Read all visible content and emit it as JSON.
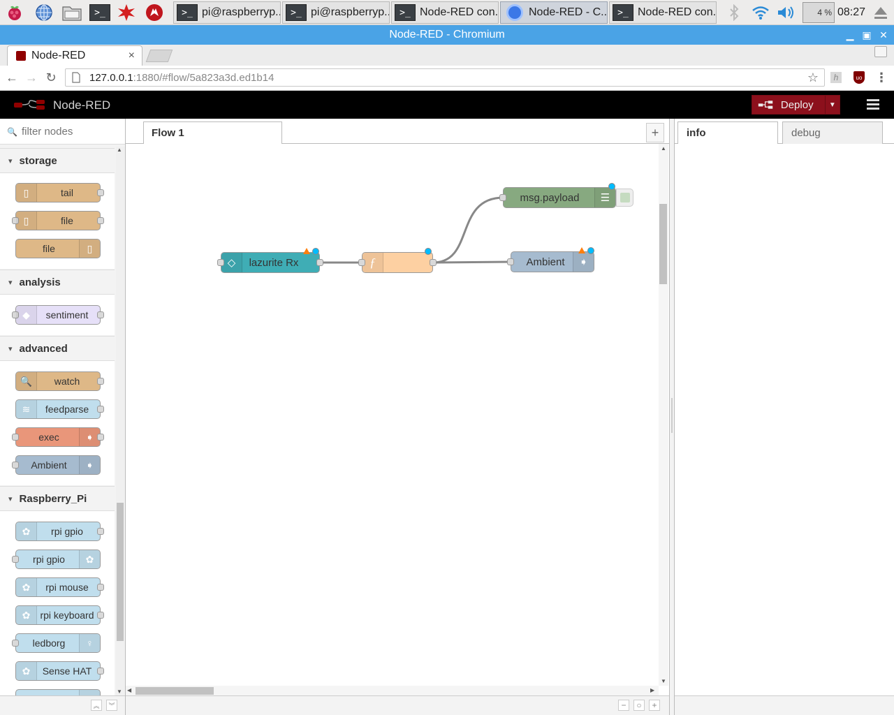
{
  "taskbar": {
    "launchers": [
      "raspberry-menu-icon",
      "web-browser-icon",
      "file-manager-icon",
      "terminal-icon",
      "math-kernel-icon",
      "wolfram-icon"
    ],
    "windows": [
      {
        "label": "pi@raspberryp...",
        "icon": "terminal"
      },
      {
        "label": "pi@raspberryp...",
        "icon": "terminal"
      },
      {
        "label": "Node-RED con...",
        "icon": "terminal"
      },
      {
        "label": "Node-RED - C...",
        "icon": "chromium",
        "active": true
      },
      {
        "label": "Node-RED con...",
        "icon": "terminal"
      }
    ],
    "cpu": "4 %",
    "clock": "08:27"
  },
  "window": {
    "title": "Node-RED - Chromium"
  },
  "browser": {
    "tab_title": "Node-RED",
    "url_host": "127.0.0.1",
    "url_path": ":1880/#flow/5a823a3d.ed1b14"
  },
  "app": {
    "brand": "Node-RED",
    "deploy_label": "Deploy",
    "accent": "#8c101c"
  },
  "palette": {
    "filter_placeholder": "filter nodes",
    "categories": [
      {
        "name": "storage",
        "nodes": [
          "tail",
          "file",
          "file"
        ]
      },
      {
        "name": "analysis",
        "nodes": [
          "sentiment"
        ]
      },
      {
        "name": "advanced",
        "nodes": [
          "watch",
          "feedparse",
          "exec",
          "Ambient"
        ]
      },
      {
        "name": "Raspberry_Pi",
        "nodes": [
          "rpi gpio",
          "rpi gpio",
          "rpi mouse",
          "rpi keyboard",
          "ledborg",
          "Sense HAT"
        ]
      }
    ]
  },
  "workspace": {
    "tab": "Flow 1",
    "add_tab": "+",
    "nodes": [
      {
        "label": "lazurite Rx",
        "color": "#3fadb5"
      },
      {
        "label": "",
        "color": "#fdd0a2"
      },
      {
        "label": "msg.payload",
        "color": "#87a980"
      },
      {
        "label": "Ambient",
        "color": "#a6bbcf"
      }
    ],
    "zoom": {
      "out": "−",
      "reset": "○",
      "in": "+"
    }
  },
  "sidebar": {
    "tabs": [
      "info",
      "debug"
    ]
  }
}
